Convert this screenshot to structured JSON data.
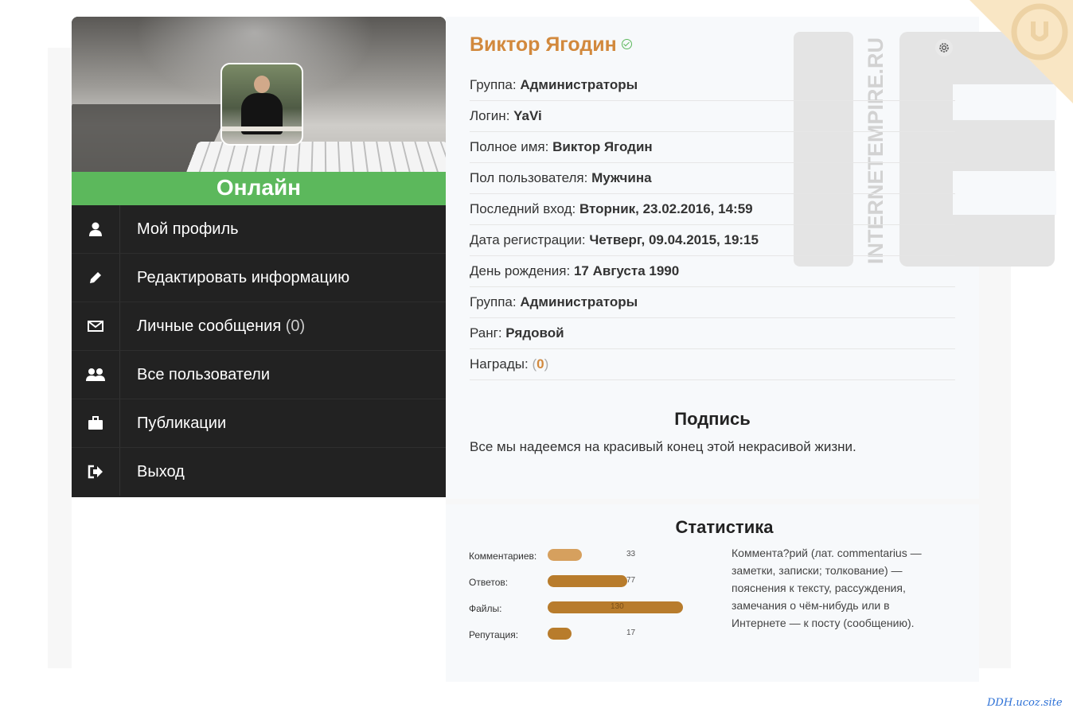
{
  "profile": {
    "name": "Виктор Ягодин",
    "status": "Онлайн",
    "rows": [
      {
        "label": "Группа:",
        "value": "Администраторы"
      },
      {
        "label": "Логин:",
        "value": "YaVi"
      },
      {
        "label": "Полное имя:",
        "value": "Виктор Ягодин"
      },
      {
        "label": "Пол пользователя:",
        "value": "Мужчина"
      },
      {
        "label": "Последний вход:",
        "value": "Вторник, 23.02.2016, 14:59"
      },
      {
        "label": "Дата регистрации:",
        "value": "Четверг, 09.04.2015, 19:15"
      },
      {
        "label": "День рождения:",
        "value": "17 Августа 1990"
      },
      {
        "label": "Группа:",
        "value": "Администраторы"
      },
      {
        "label": "Ранг:",
        "value": "Рядовой"
      },
      {
        "label": "Награды:",
        "value_prefix": "(",
        "value": "0",
        "value_suffix": ")"
      }
    ]
  },
  "menu": [
    {
      "label": "Мой профиль",
      "icon": "user-icon"
    },
    {
      "label": "Редактировать информацию",
      "icon": "pencil-icon"
    },
    {
      "label": "Личные сообщения",
      "count": "(0)",
      "icon": "envelope-icon"
    },
    {
      "label": "Все пользователи",
      "icon": "users-icon"
    },
    {
      "label": "Публикации",
      "icon": "briefcase-icon"
    },
    {
      "label": "Выход",
      "icon": "sign-out-icon"
    }
  ],
  "signature": {
    "title": "Подпись",
    "text": "Все мы надеемся на красивый конец этой некрасивой жизни."
  },
  "stats": {
    "title": "Статистика",
    "items": [
      {
        "label": "Комментариев:",
        "value": "33",
        "fraction": 0.25
      },
      {
        "label": "Ответов:",
        "value": "77",
        "fraction": 0.59
      },
      {
        "label": "Файлы:",
        "value": "130",
        "fraction": 1.0
      },
      {
        "label": "Репутация:",
        "value": "17",
        "fraction": 0.13
      }
    ],
    "description": "Коммента?рий (лат. commentarius — заметки, записки; толкование) — пояснения к тексту, рассуждения, замечания о чём-нибудь или в Интернете — к посту (сообщению)."
  },
  "watermark": {
    "text": "INTERNETEMPIRE.RU"
  },
  "footer": {
    "link": "DDH.ucoz.site"
  },
  "colors": {
    "accent": "#d2893d",
    "online": "#5cb85c",
    "menu_bg": "#222222",
    "bar_light": "#d6a05e",
    "bar_dark": "#b87c2c"
  }
}
